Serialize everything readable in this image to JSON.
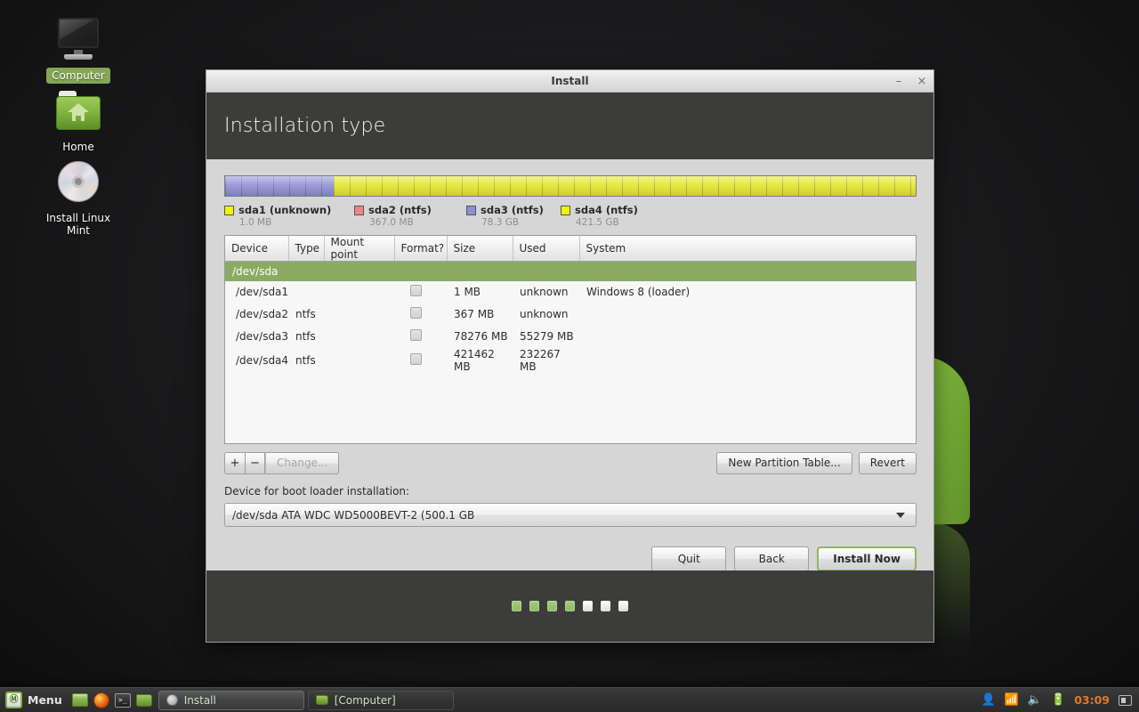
{
  "desktop": {
    "icons": [
      {
        "label": "Computer",
        "icon": "computer-monitor-icon",
        "selected": true
      },
      {
        "label": "Home",
        "icon": "home-folder-icon",
        "selected": false
      },
      {
        "label": "Install Linux Mint",
        "icon": "cd-disc-icon",
        "selected": false
      }
    ]
  },
  "window": {
    "title": "Install",
    "minimize_label": "–",
    "close_label": "×",
    "page_title": "Installation type"
  },
  "partition_bar": {
    "segments": [
      {
        "name": "sda3",
        "color": "#8d8fd4",
        "percent": 15.7
      },
      {
        "name": "sda4",
        "color": "#e5e52e",
        "percent": 84.3
      }
    ]
  },
  "legend": [
    {
      "name": "sda1 (unknown)",
      "size": "1.0 MB",
      "color": "#f2f20d"
    },
    {
      "name": "sda2 (ntfs)",
      "size": "367.0 MB",
      "color": "#ef8585"
    },
    {
      "name": "sda3 (ntfs)",
      "size": "78.3 GB",
      "color": "#8d8fd4"
    },
    {
      "name": "sda4 (ntfs)",
      "size": "421.5 GB",
      "color": "#f2f20d"
    }
  ],
  "table": {
    "columns": [
      "Device",
      "Type",
      "Mount point",
      "Format?",
      "Size",
      "Used",
      "System"
    ],
    "disk_row": "/dev/sda",
    "rows": [
      {
        "device": "/dev/sda1",
        "type": "",
        "mount": "",
        "format": false,
        "size": "1 MB",
        "used": "unknown",
        "system": "Windows 8 (loader)"
      },
      {
        "device": "/dev/sda2",
        "type": "ntfs",
        "mount": "",
        "format": false,
        "size": "367 MB",
        "used": "unknown",
        "system": ""
      },
      {
        "device": "/dev/sda3",
        "type": "ntfs",
        "mount": "",
        "format": false,
        "size": "78276 MB",
        "used": "55279 MB",
        "system": ""
      },
      {
        "device": "/dev/sda4",
        "type": "ntfs",
        "mount": "",
        "format": false,
        "size": "421462 MB",
        "used": "232267 MB",
        "system": ""
      }
    ]
  },
  "toolbar": {
    "add_label": "+",
    "remove_label": "−",
    "change_label": "Change...",
    "new_partition_table_label": "New Partition Table...",
    "revert_label": "Revert"
  },
  "bootloader": {
    "label": "Device for boot loader installation:",
    "value": "/dev/sda   ATA WDC WD5000BEVT-2 (500.1 GB"
  },
  "nav": {
    "quit_label": "Quit",
    "back_label": "Back",
    "install_label": "Install Now"
  },
  "footer": {
    "dots_total": 7,
    "dots_filled": 4
  },
  "panel": {
    "menu_label": "Menu",
    "mint_glyph": "Ⓜ",
    "launchers": [
      {
        "name": "show-desktop-icon"
      },
      {
        "name": "firefox-icon"
      },
      {
        "name": "terminal-icon",
        "glyph": ">_"
      },
      {
        "name": "file-manager-icon"
      }
    ],
    "tasks": [
      {
        "label": "Install",
        "icon": "cd-disc-icon",
        "active": true
      },
      {
        "label": "[Computer]",
        "icon": "folder-icon",
        "active": false
      }
    ],
    "tray": {
      "user_icon": "\u0001",
      "wifi_icon": "wifi-icon",
      "volume_icon": "volume-icon",
      "battery_icon": "battery-icon",
      "clock": "03:09",
      "workspace_icon": "workspace-switcher-icon"
    }
  },
  "colors": {
    "accent_green": "#8cb85c",
    "header_dark": "#3c3c3b",
    "disk_row_green": "#8bab63",
    "clock_orange": "#e07a2a"
  }
}
